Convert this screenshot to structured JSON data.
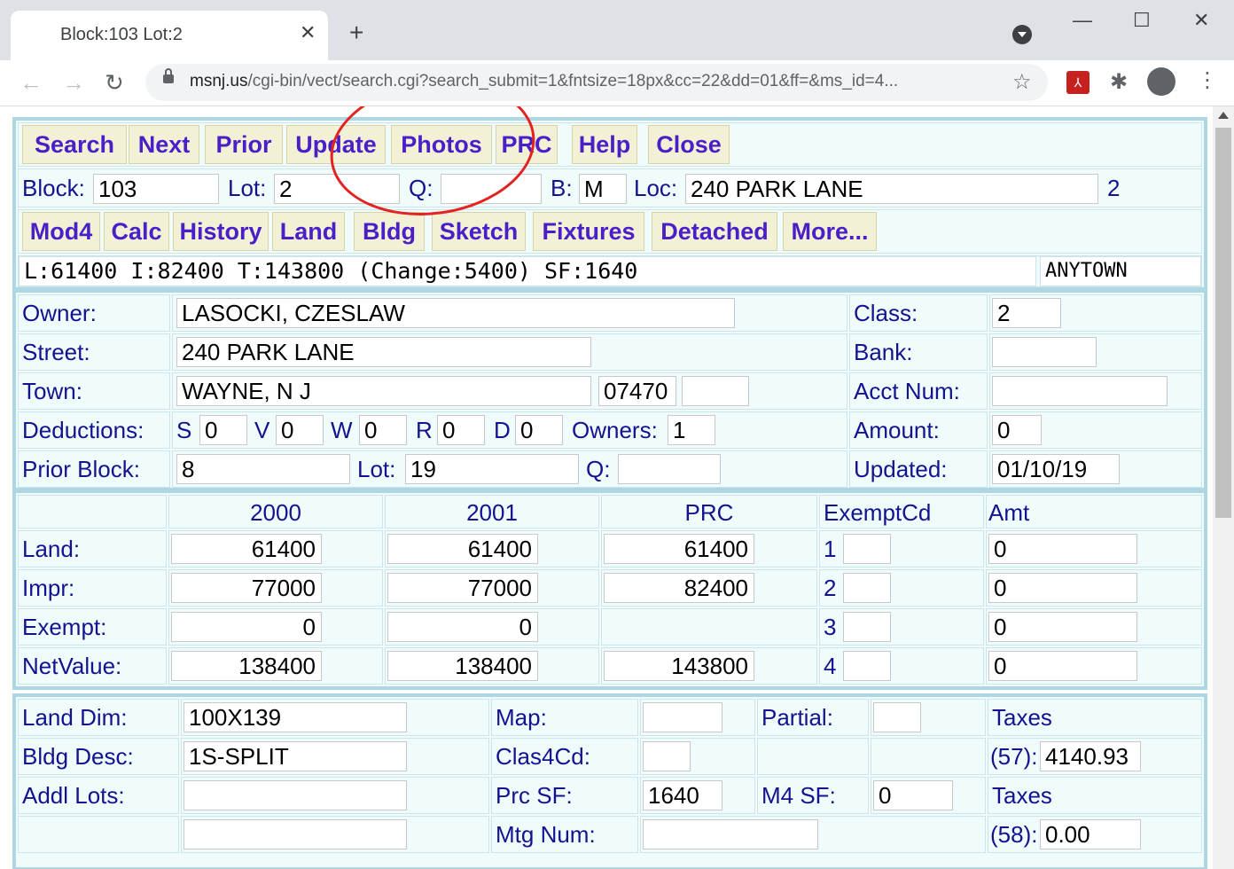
{
  "browser": {
    "tab_title": "Block:103 Lot:2",
    "tab_close": "✕",
    "new_tab": "+",
    "min": "—",
    "max": "☐",
    "close": "✕",
    "back": "←",
    "forward": "→",
    "reload": "↻",
    "url_host": "msnj.us",
    "url_rest": "/cgi-bin/vect/search.cgi?search_submit=1&fntsize=18px&cc=22&dd=01&ff=&ms_id=4...",
    "star": "☆",
    "pdf_ext": "⅄",
    "puzzle": "✱",
    "kebab": "⋮"
  },
  "nav": {
    "buttons": [
      "Search",
      "Next",
      "Prior",
      "Update",
      "Photos",
      "PRC",
      "Help",
      "Close"
    ],
    "block_label": "Block:",
    "block_value": "103",
    "lot_label": "Lot:",
    "lot_value": "2",
    "q_label": "Q:",
    "q_value": "",
    "b_label": "B:",
    "b_value": "M",
    "loc_label": "Loc:",
    "loc_value": "240 PARK LANE",
    "loc_suffix": "2",
    "buttons2": [
      "Mod4",
      "Calc",
      "History",
      "Land",
      "Bldg",
      "Sketch",
      "Fixtures",
      "Detached",
      "More..."
    ],
    "summary": "L:61400 I:82400 T:143800 (Change:5400) SF:1640",
    "town_code": "ANYTOWN"
  },
  "owner": {
    "owner_label": "Owner:",
    "owner_value": "LASOCKI, CZESLAW",
    "street_label": "Street:",
    "street_value": "240 PARK LANE",
    "town_label": "Town:",
    "town_value": "WAYNE, N J",
    "zip": "07470",
    "zip_ext": "",
    "deductions_label": "Deductions:",
    "ded_s_label": "S",
    "ded_s": "0",
    "ded_v_label": "V",
    "ded_v": "0",
    "ded_w_label": "W",
    "ded_w": "0",
    "ded_r_label": "R",
    "ded_r": "0",
    "ded_d_label": "D",
    "ded_d": "0",
    "owners_label": "Owners:",
    "owners_value": "1",
    "prior_block_label": "Prior Block:",
    "prior_block_value": "8",
    "prior_lot_label": "Lot:",
    "prior_lot_value": "19",
    "prior_q_label": "Q:",
    "prior_q_value": "",
    "class_label": "Class:",
    "class_value": "2",
    "bank_label": "Bank:",
    "bank_value": "",
    "acct_label": "Acct Num:",
    "acct_value": "",
    "amount_label": "Amount:",
    "amount_value": "0",
    "updated_label": "Updated:",
    "updated_value": "01/10/19"
  },
  "values": {
    "headers": [
      "2000",
      "2001",
      "PRC",
      "ExemptCd",
      "Amt"
    ],
    "rows": [
      {
        "label": "Land:",
        "v2000": "61400",
        "v2001": "61400",
        "prc": "61400",
        "ex_num": "1",
        "ex_code": "",
        "amt": "0"
      },
      {
        "label": "Impr:",
        "v2000": "77000",
        "v2001": "77000",
        "prc": "82400",
        "ex_num": "2",
        "ex_code": "",
        "amt": "0"
      },
      {
        "label": "Exempt:",
        "v2000": "0",
        "v2001": "0",
        "prc": "",
        "ex_num": "3",
        "ex_code": "",
        "amt": "0"
      },
      {
        "label": "NetValue:",
        "v2000": "138400",
        "v2001": "138400",
        "prc": "143800",
        "ex_num": "4",
        "ex_code": "",
        "amt": "0"
      }
    ]
  },
  "details": {
    "land_dim_label": "Land Dim:",
    "land_dim_value": "100X139",
    "bldg_desc_label": "Bldg Desc:",
    "bldg_desc_value": "1S-SPLIT",
    "addl_lots_label": "Addl Lots:",
    "addl_lots_value": "",
    "addl_lots_value2": "",
    "map_label": "Map:",
    "map_value": "",
    "clas4_label": "Clas4Cd:",
    "clas4_value": "",
    "prc_sf_label": "Prc SF:",
    "prc_sf_value": "1640",
    "mtg_label": "Mtg Num:",
    "mtg_value": "",
    "partial_label": "Partial:",
    "partial_value": "",
    "m4sf_label": "M4 SF:",
    "m4sf_value": "0",
    "taxes_label1": "Taxes",
    "tax57_label": "(57):",
    "tax57_value": "4140.93",
    "taxes_label2": "Taxes",
    "tax58_label": "(58):",
    "tax58_value": "0.00"
  }
}
